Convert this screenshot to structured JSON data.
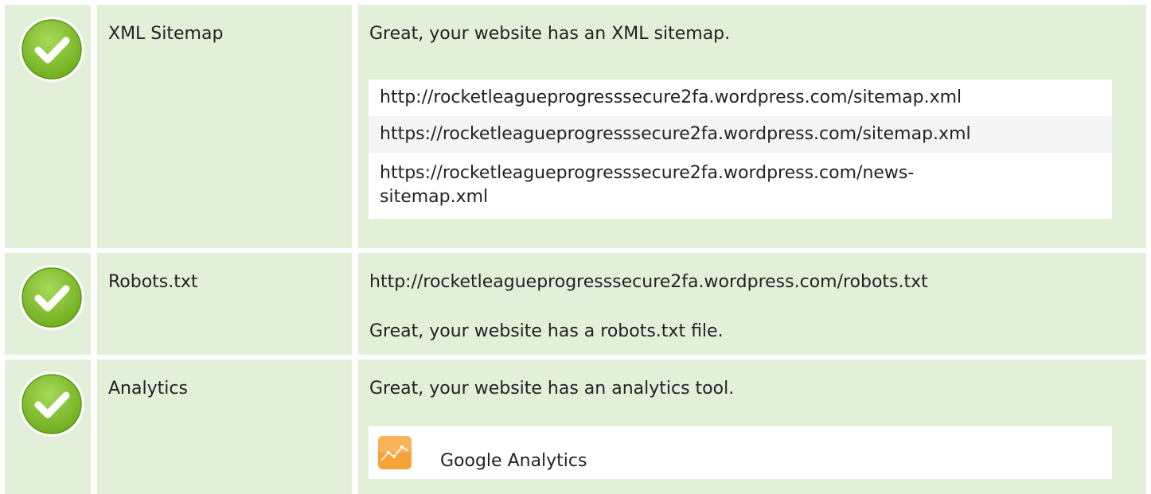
{
  "rows": [
    {
      "label": "XML Sitemap",
      "status_icon": "check-circle-icon",
      "status": "passed",
      "message": "Great, your website has an XML sitemap.",
      "urls": [
        "http://rocketleagueprogresssecure2fa.wordpress.com/sitemap.xml",
        "https://rocketleagueprogresssecure2fa.wordpress.com/sitemap.xml",
        "https://rocketleagueprogresssecure2fa.wordpress.com/news-\nsitemap.xml"
      ]
    },
    {
      "label": "Robots.txt",
      "status_icon": "check-circle-icon",
      "status": "passed",
      "url": "http://rocketleagueprogresssecure2fa.wordpress.com/robots.txt",
      "message": "Great, your website has a robots.txt file."
    },
    {
      "label": "Analytics",
      "status_icon": "check-circle-icon",
      "status": "passed",
      "message": "Great, your website has an analytics tool.",
      "tool": {
        "name": "Google Analytics",
        "icon": "google-analytics-icon"
      }
    }
  ],
  "colors": {
    "row_background": "#e2f0d9",
    "check_green": "#8cc63f",
    "analytics_orange": "#f7a13b"
  }
}
